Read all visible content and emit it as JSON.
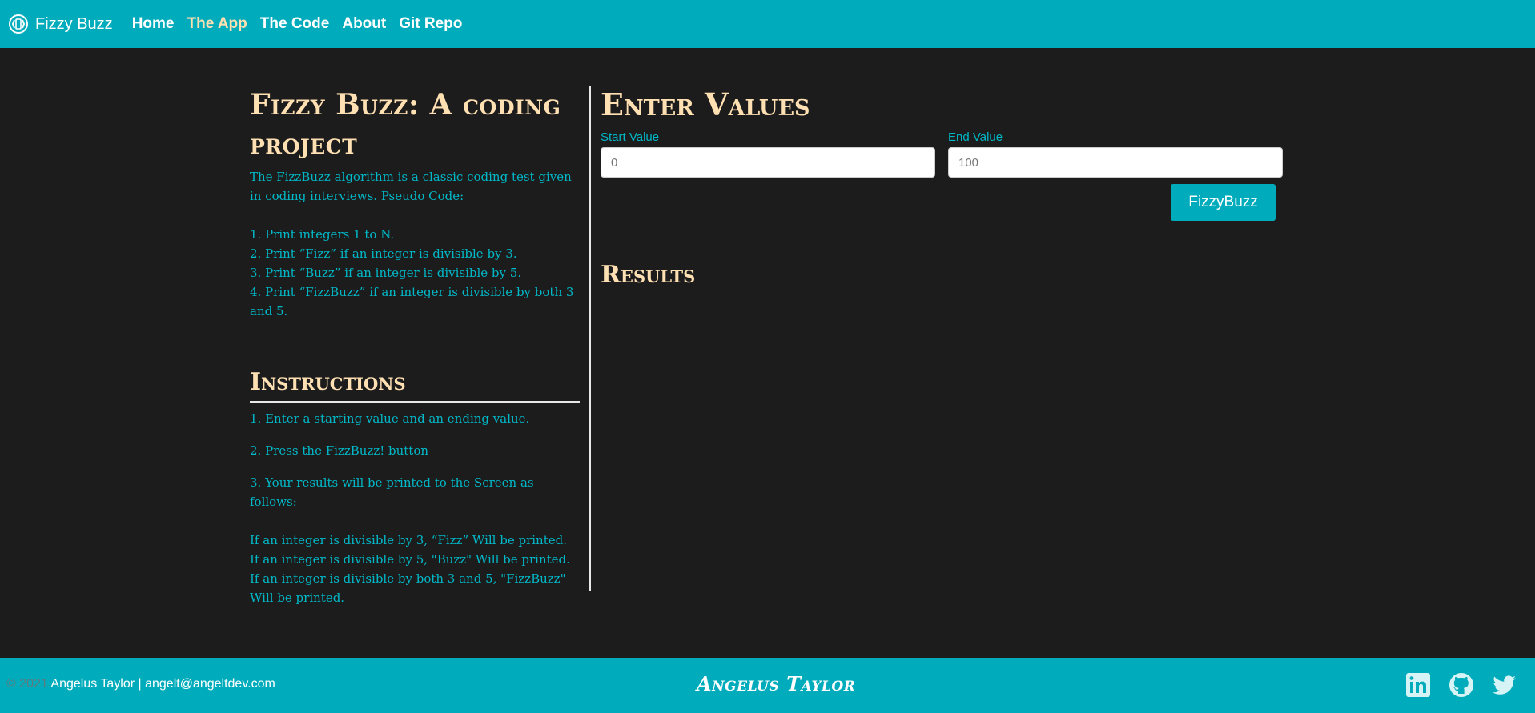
{
  "nav": {
    "brand": "Fizzy Buzz",
    "links": [
      {
        "label": "Home",
        "active": false
      },
      {
        "label": "The App",
        "active": true
      },
      {
        "label": "The Code",
        "active": false
      },
      {
        "label": "About",
        "active": false
      },
      {
        "label": "Git Repo",
        "active": false
      }
    ]
  },
  "left": {
    "title": "Fizzy Buzz: A coding project",
    "intro": "The FizzBuzz algorithm is a classic coding test given in coding interviews. Pseudo Code:",
    "steps": [
      "1. Print integers 1 to N.",
      "2. Print “Fizz” if an integer is divisible by 3.",
      "3. Print “Buzz” if an integer is divisible by 5.",
      "4. Print “FizzBuzz” if an integer is divisible by both 3 and 5."
    ],
    "instructions_heading": "Instructions",
    "instructions": [
      "1. Enter a starting value and an ending value.",
      "2. Press the FizzBuzz! button",
      "3. Your results will be printed to the Screen as follows:"
    ],
    "rules": [
      "If an integer is divisible by 3, “Fizz” Will be printed.",
      "If an integer is divisible by 5, \"Buzz\" Will be printed.",
      "If an integer is divisible by both 3 and 5, \"FizzBuzz\" Will be printed."
    ]
  },
  "right": {
    "heading": "Enter Values",
    "start_label": "Start Value",
    "start_placeholder": "0",
    "end_label": "End Value",
    "end_placeholder": "100",
    "button_label": "FizzyBuzz",
    "results_heading": "Results"
  },
  "footer": {
    "copyright": "© 2021",
    "contact": "Angelus Taylor | angelt@angeltdev.com",
    "logo_text": "Angelus Taylor",
    "icons": [
      "linkedin-icon",
      "github-icon",
      "twitter-icon"
    ]
  },
  "colors": {
    "accent": "#00acbb",
    "heading": "#ffe0b2",
    "text": "#00b8c8",
    "background": "#1c1c1c"
  }
}
